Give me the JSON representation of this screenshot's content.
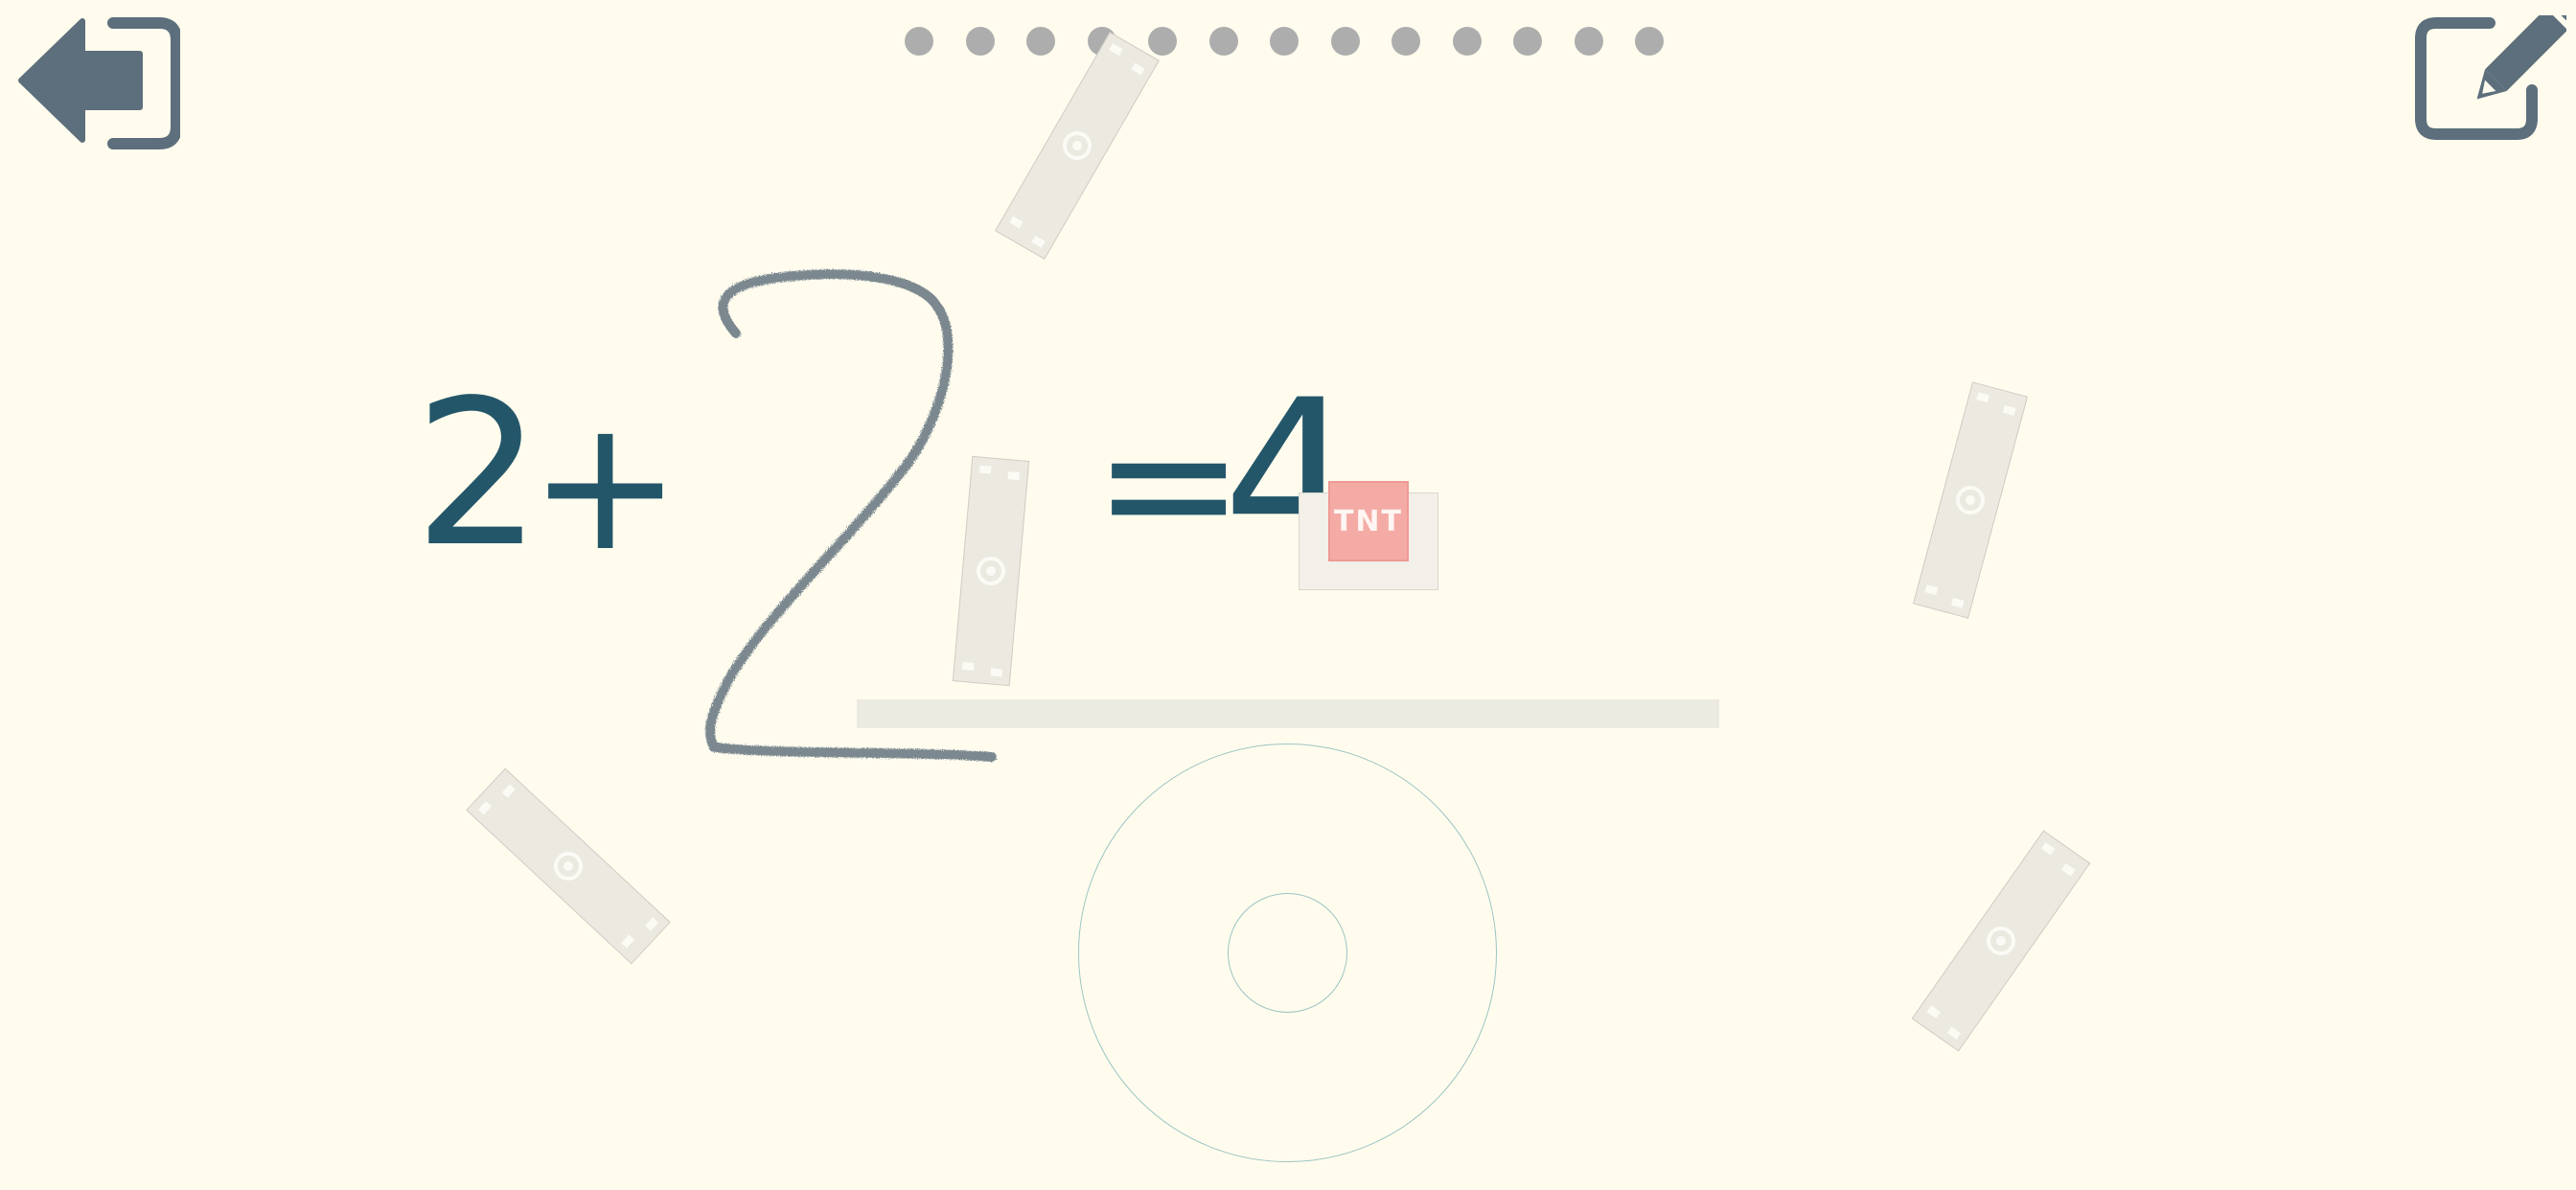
{
  "level_dots": {
    "total": 13
  },
  "equation": {
    "first": "2",
    "plus": "+",
    "handwritten_answer": "2",
    "equals": "=",
    "result": "4"
  },
  "tnt_label": "TNT",
  "colors": {
    "background": "#fffcee",
    "equation": "#245669",
    "dot": "#adadad",
    "plank": "#ebe9e0",
    "tnt": "#f5aba5",
    "wheel_outline": "#9cc5c2",
    "icon": "#5d6f7c"
  },
  "icons": {
    "back": "exit-arrow-icon",
    "edit": "edit-pencil-icon"
  }
}
